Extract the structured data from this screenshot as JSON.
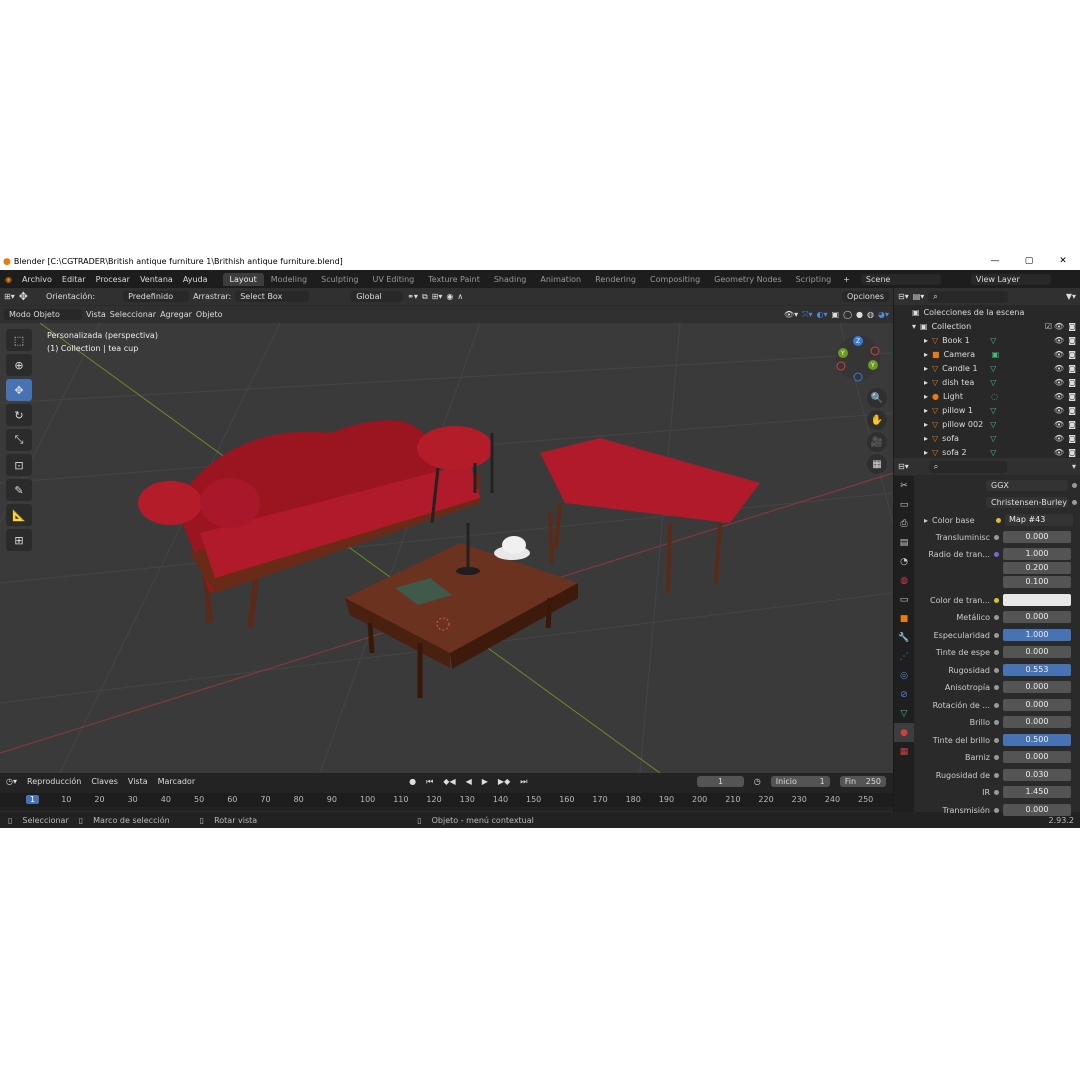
{
  "title": "Blender [C:\\CGTRADER\\British antique furniture 1\\Brithish antique furniture.blend]",
  "menu": [
    "Archivo",
    "Editar",
    "Procesar",
    "Ventana",
    "Ayuda"
  ],
  "workspaces": [
    "Layout",
    "Modeling",
    "Sculpting",
    "UV Editing",
    "Texture Paint",
    "Shading",
    "Animation",
    "Rendering",
    "Compositing",
    "Geometry Nodes",
    "Scripting"
  ],
  "scene": "Scene",
  "view_layer": "View Layer",
  "header": {
    "orientation_label": "Orientación:",
    "orientation_value": "Predefinido",
    "drag_label": "Arrastrar:",
    "drag_value": "Select Box",
    "transform": "Global",
    "options": "Opciones"
  },
  "viewport_header": {
    "mode": "Modo Objeto",
    "vista": "Vista",
    "seleccionar": "Seleccionar",
    "agregar": "Agregar",
    "objeto": "Objeto"
  },
  "viewport": {
    "line1": "Personalizada (perspectiva)",
    "line2": "(1) Collection | tea cup"
  },
  "outliner": {
    "scene_collection": "Colecciones de la escena",
    "collection": "Collection",
    "items": [
      "Book 1",
      "Camera",
      "Candle 1",
      "dish tea",
      "Light",
      "pillow 1",
      "pillow 002",
      "sofa",
      "sofa 2"
    ]
  },
  "properties": {
    "distribution": "GGX",
    "subsurface_method": "Christensen-Burley",
    "base_color_label": "Color base",
    "base_color_value": "Map #43",
    "rows": [
      {
        "label": "Transluminisc",
        "value": "0.000"
      },
      {
        "label": "Radio de tran...",
        "value": "1.000"
      },
      {
        "label": "",
        "value": "0.200"
      },
      {
        "label": "",
        "value": "0.100"
      },
      {
        "label": "Color de tran...",
        "value": ""
      },
      {
        "label": "Metálico",
        "value": "0.000"
      },
      {
        "label": "Especularidad",
        "value": "1.000"
      },
      {
        "label": "Tinte de espe",
        "value": "0.000"
      },
      {
        "label": "Rugosidad",
        "value": "0.553"
      },
      {
        "label": "Anisotropía",
        "value": "0.000"
      },
      {
        "label": "Rotación de ...",
        "value": "0.000"
      },
      {
        "label": "Brillo",
        "value": "0.000"
      },
      {
        "label": "Tinte del brillo",
        "value": "0.500"
      },
      {
        "label": "Barniz",
        "value": "0.000"
      },
      {
        "label": "Rugosidad de",
        "value": "0.030"
      },
      {
        "label": "IR",
        "value": "1.450"
      },
      {
        "label": "Transmisión",
        "value": "0.000"
      }
    ]
  },
  "timeline": {
    "reproduccion": "Reproducción",
    "claves": "Claves",
    "vista": "Vista",
    "marcador": "Marcador",
    "current": "1",
    "inicio_label": "Inicio",
    "inicio": "1",
    "fin_label": "Fin",
    "fin": "250",
    "ticks": [
      "1",
      "10",
      "20",
      "30",
      "40",
      "50",
      "60",
      "70",
      "80",
      "90",
      "100",
      "110",
      "120",
      "130",
      "140",
      "150",
      "160",
      "170",
      "180",
      "190",
      "200",
      "210",
      "220",
      "230",
      "240",
      "250"
    ]
  },
  "status": {
    "s1": "Seleccionar",
    "s2": "Marco de selección",
    "s3": "Rotar vista",
    "s4": "Objeto - menú contextual",
    "version": "2.93.2"
  }
}
